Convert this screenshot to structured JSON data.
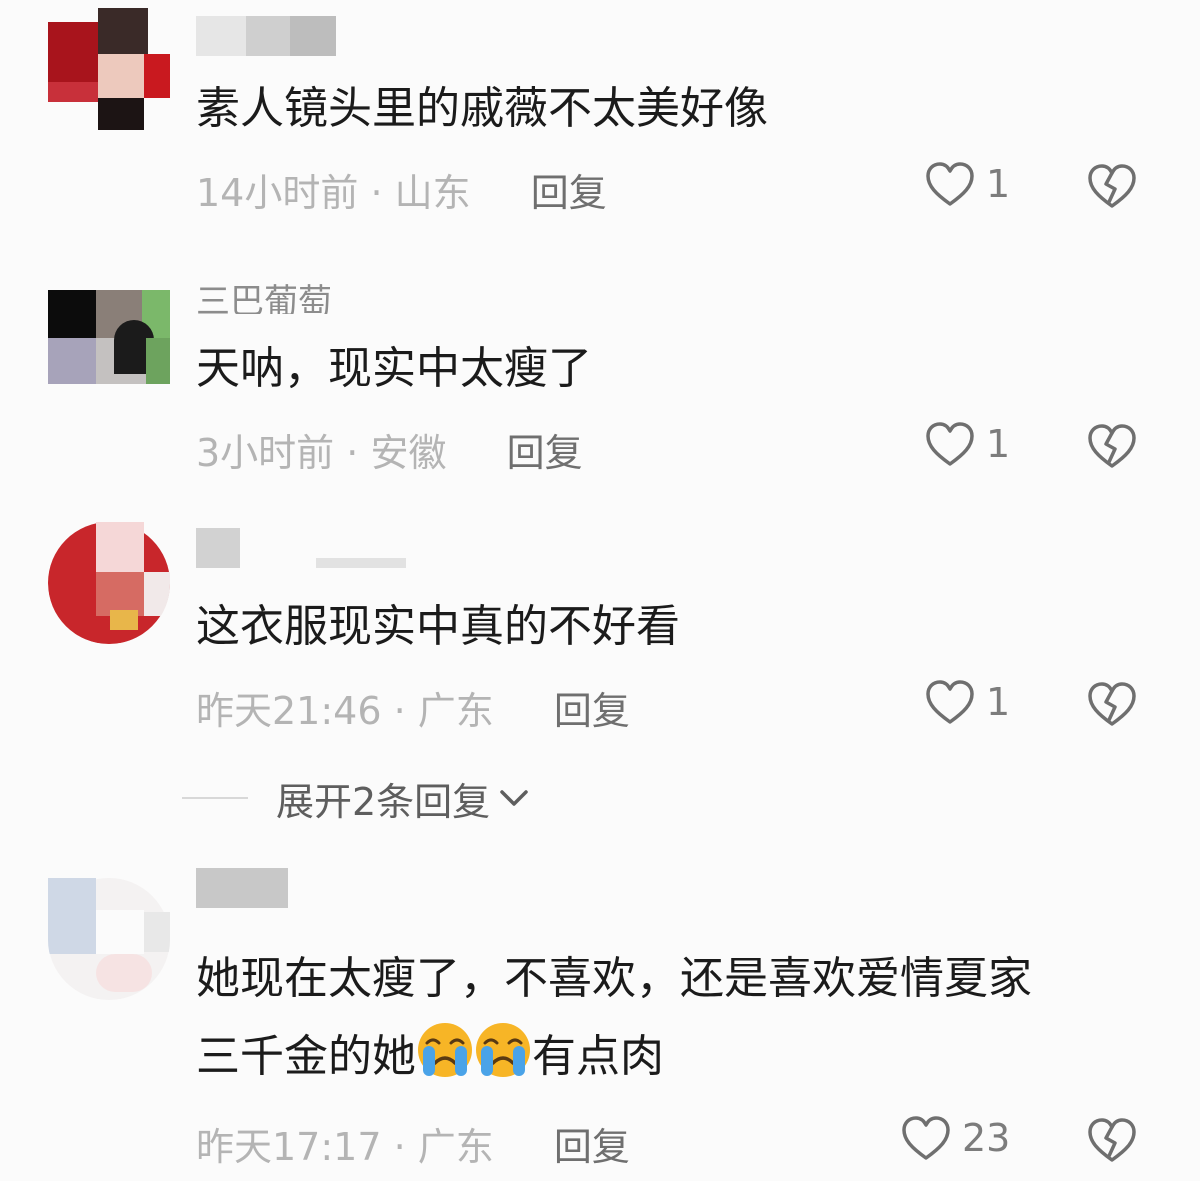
{
  "comments": [
    {
      "text": "素人镜头里的戚薇不太美好像",
      "time": "14小时前",
      "location": "山东",
      "reply_label": "回复",
      "likes": "1"
    },
    {
      "username": "三巴葡萄",
      "text": "天呐，现实中太瘦了",
      "time": "3小时前",
      "location": "安徽",
      "reply_label": "回复",
      "likes": "1"
    },
    {
      "text": "这衣服现实中真的不好看",
      "time": "昨天21:46",
      "location": "广东",
      "reply_label": "回复",
      "likes": "1",
      "expand_label": "展开2条回复"
    },
    {
      "text_line1": "她现在太瘦了，不喜欢，还是喜欢爱情夏家",
      "text_line2_a": "三千金的她",
      "text_line2_b": "有点肉",
      "time": "昨天17:17",
      "location": "广东",
      "reply_label": "回复",
      "likes": "23"
    }
  ],
  "meta_separator": "·",
  "icons": {
    "like": "heart-outline-icon",
    "dislike": "broken-heart-icon",
    "expand": "chevron-down-icon",
    "emoji": "crying-face-emoji"
  },
  "colors": {
    "background": "#fbfbfb",
    "text": "#1b1b1b",
    "meta": "#b4b4b4",
    "icon": "#6f6f6f"
  }
}
